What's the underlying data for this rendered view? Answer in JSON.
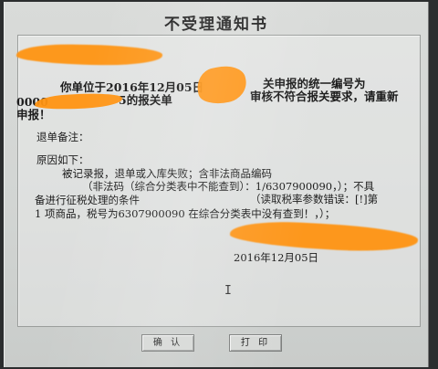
{
  "dialog": {
    "title": "不受理通知书",
    "lines": [
      "你单位于2016年12月05日",
      "关申报的统一编号为",
      "0000",
      "5的报关单",
      "审核不符合报关要求，请重新",
      "申报！",
      "退单备注：",
      "原因如下：",
      "被记录报，退单或入库失败；含非法商品编码",
      "（非法码（综合分类表中不能查到）：1/6307900090，）；不具",
      "备进行征税处理的条件",
      "（读取税率参数错误：[!]第",
      "1 项商品，税号为6307900090 在综合分类表中没有查到！，）；",
      "2016年12月05日"
    ],
    "cursor": "I"
  },
  "buttons": {
    "confirm": "确 认",
    "print": "打 印"
  },
  "colors": {
    "redaction": "#ff9412",
    "window_bg": "#d4d7d5",
    "text": "#1c1c1c"
  }
}
